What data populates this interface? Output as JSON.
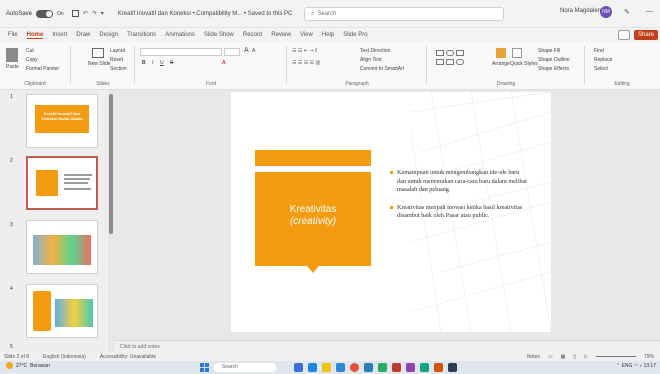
{
  "titlebar": {
    "autosave_label": "AutoSave",
    "autosave_state": "On",
    "doc_title": "Kreatif Inovatif dan Koneksi • Compatibility M... • Saved to this PC",
    "search_placeholder": "Search",
    "user_name": "Nora Magdalen",
    "user_initials": "NM"
  },
  "tabs": [
    "File",
    "Home",
    "Insert",
    "Draw",
    "Design",
    "Transitions",
    "Animations",
    "Slide Show",
    "Record",
    "Review",
    "View",
    "Help",
    "Slide Pro"
  ],
  "active_tab": "Home",
  "share_label": "Share",
  "ribbon": {
    "clipboard": {
      "label": "Clipboard",
      "paste": "Paste",
      "cut": "Cut",
      "copy": "Copy",
      "format_painter": "Format Painter"
    },
    "slides": {
      "label": "Slides",
      "new_slide": "New Slide",
      "layout": "Layout",
      "reset": "Reset",
      "section": "Section"
    },
    "font": {
      "label": "Font",
      "size_grow": "A",
      "size_shrink": "A"
    },
    "paragraph": {
      "label": "Paragraph",
      "text_direction": "Text Direction",
      "align_text": "Align Text",
      "smartart": "Convert to SmartArt"
    },
    "drawing": {
      "label": "Drawing",
      "arrange": "Arrange",
      "quick_styles": "Quick Styles",
      "shape_fill": "Shape Fill",
      "shape_outline": "Shape Outline",
      "shape_effects": "Shape Effects"
    },
    "editing": {
      "label": "Editing",
      "find": "Find",
      "replace": "Replace",
      "select": "Select"
    }
  },
  "slides_panel": {
    "numbers": [
      "1",
      "2",
      "3",
      "4",
      "5"
    ],
    "thumb1_title": "Kreatif Inovatif dan Koneksi Dunia Usaha"
  },
  "slide": {
    "title_line1": "Kreativitas",
    "title_line2": "(creativity)",
    "bullet1": "Kemampuan untuk mengembangkan ide-ide baru dan untuk menemukan cara-cara baru dalam melihat masalah dan peluang.",
    "bullet2": "Kreativitas menjadi inovasi ketika hasil kreativitas disambut baik oleh Pasar atau public."
  },
  "notes_placeholder": "Click to add notes",
  "status": {
    "slide_of": "Slide 2 of 8",
    "language": "English (Indonesia)",
    "accessibility": "Accessibility: Unavailable",
    "notes": "Notes",
    "zoom": "79%"
  },
  "taskbar": {
    "weather_temp": "27°C",
    "weather_text": "Berawan",
    "search": "Search",
    "lang": "ENG",
    "time": "13:17"
  },
  "colors": {
    "accent": "#c43e1c",
    "orange": "#f39c12",
    "selected_thumb": "#c25b4e"
  }
}
